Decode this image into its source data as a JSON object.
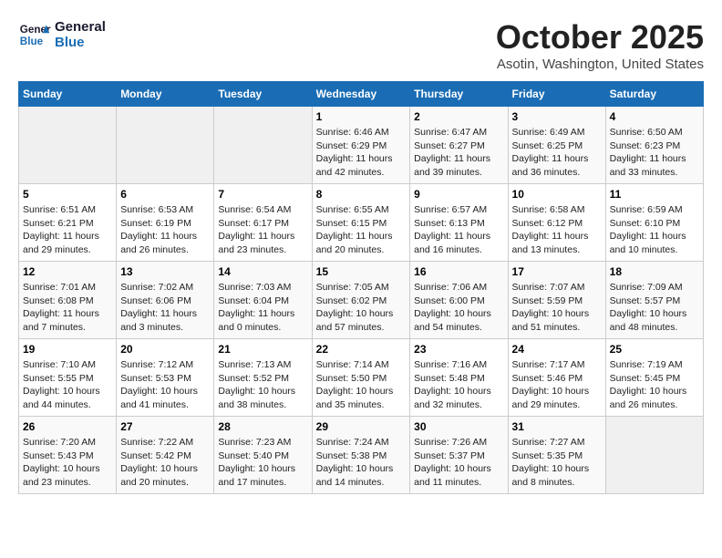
{
  "header": {
    "logo_line1": "General",
    "logo_line2": "Blue",
    "month": "October 2025",
    "location": "Asotin, Washington, United States"
  },
  "days_of_week": [
    "Sunday",
    "Monday",
    "Tuesday",
    "Wednesday",
    "Thursday",
    "Friday",
    "Saturday"
  ],
  "weeks": [
    [
      {
        "day": "",
        "content": ""
      },
      {
        "day": "",
        "content": ""
      },
      {
        "day": "",
        "content": ""
      },
      {
        "day": "1",
        "content": "Sunrise: 6:46 AM\nSunset: 6:29 PM\nDaylight: 11 hours\nand 42 minutes."
      },
      {
        "day": "2",
        "content": "Sunrise: 6:47 AM\nSunset: 6:27 PM\nDaylight: 11 hours\nand 39 minutes."
      },
      {
        "day": "3",
        "content": "Sunrise: 6:49 AM\nSunset: 6:25 PM\nDaylight: 11 hours\nand 36 minutes."
      },
      {
        "day": "4",
        "content": "Sunrise: 6:50 AM\nSunset: 6:23 PM\nDaylight: 11 hours\nand 33 minutes."
      }
    ],
    [
      {
        "day": "5",
        "content": "Sunrise: 6:51 AM\nSunset: 6:21 PM\nDaylight: 11 hours\nand 29 minutes."
      },
      {
        "day": "6",
        "content": "Sunrise: 6:53 AM\nSunset: 6:19 PM\nDaylight: 11 hours\nand 26 minutes."
      },
      {
        "day": "7",
        "content": "Sunrise: 6:54 AM\nSunset: 6:17 PM\nDaylight: 11 hours\nand 23 minutes."
      },
      {
        "day": "8",
        "content": "Sunrise: 6:55 AM\nSunset: 6:15 PM\nDaylight: 11 hours\nand 20 minutes."
      },
      {
        "day": "9",
        "content": "Sunrise: 6:57 AM\nSunset: 6:13 PM\nDaylight: 11 hours\nand 16 minutes."
      },
      {
        "day": "10",
        "content": "Sunrise: 6:58 AM\nSunset: 6:12 PM\nDaylight: 11 hours\nand 13 minutes."
      },
      {
        "day": "11",
        "content": "Sunrise: 6:59 AM\nSunset: 6:10 PM\nDaylight: 11 hours\nand 10 minutes."
      }
    ],
    [
      {
        "day": "12",
        "content": "Sunrise: 7:01 AM\nSunset: 6:08 PM\nDaylight: 11 hours\nand 7 minutes."
      },
      {
        "day": "13",
        "content": "Sunrise: 7:02 AM\nSunset: 6:06 PM\nDaylight: 11 hours\nand 3 minutes."
      },
      {
        "day": "14",
        "content": "Sunrise: 7:03 AM\nSunset: 6:04 PM\nDaylight: 11 hours\nand 0 minutes."
      },
      {
        "day": "15",
        "content": "Sunrise: 7:05 AM\nSunset: 6:02 PM\nDaylight: 10 hours\nand 57 minutes."
      },
      {
        "day": "16",
        "content": "Sunrise: 7:06 AM\nSunset: 6:00 PM\nDaylight: 10 hours\nand 54 minutes."
      },
      {
        "day": "17",
        "content": "Sunrise: 7:07 AM\nSunset: 5:59 PM\nDaylight: 10 hours\nand 51 minutes."
      },
      {
        "day": "18",
        "content": "Sunrise: 7:09 AM\nSunset: 5:57 PM\nDaylight: 10 hours\nand 48 minutes."
      }
    ],
    [
      {
        "day": "19",
        "content": "Sunrise: 7:10 AM\nSunset: 5:55 PM\nDaylight: 10 hours\nand 44 minutes."
      },
      {
        "day": "20",
        "content": "Sunrise: 7:12 AM\nSunset: 5:53 PM\nDaylight: 10 hours\nand 41 minutes."
      },
      {
        "day": "21",
        "content": "Sunrise: 7:13 AM\nSunset: 5:52 PM\nDaylight: 10 hours\nand 38 minutes."
      },
      {
        "day": "22",
        "content": "Sunrise: 7:14 AM\nSunset: 5:50 PM\nDaylight: 10 hours\nand 35 minutes."
      },
      {
        "day": "23",
        "content": "Sunrise: 7:16 AM\nSunset: 5:48 PM\nDaylight: 10 hours\nand 32 minutes."
      },
      {
        "day": "24",
        "content": "Sunrise: 7:17 AM\nSunset: 5:46 PM\nDaylight: 10 hours\nand 29 minutes."
      },
      {
        "day": "25",
        "content": "Sunrise: 7:19 AM\nSunset: 5:45 PM\nDaylight: 10 hours\nand 26 minutes."
      }
    ],
    [
      {
        "day": "26",
        "content": "Sunrise: 7:20 AM\nSunset: 5:43 PM\nDaylight: 10 hours\nand 23 minutes."
      },
      {
        "day": "27",
        "content": "Sunrise: 7:22 AM\nSunset: 5:42 PM\nDaylight: 10 hours\nand 20 minutes."
      },
      {
        "day": "28",
        "content": "Sunrise: 7:23 AM\nSunset: 5:40 PM\nDaylight: 10 hours\nand 17 minutes."
      },
      {
        "day": "29",
        "content": "Sunrise: 7:24 AM\nSunset: 5:38 PM\nDaylight: 10 hours\nand 14 minutes."
      },
      {
        "day": "30",
        "content": "Sunrise: 7:26 AM\nSunset: 5:37 PM\nDaylight: 10 hours\nand 11 minutes."
      },
      {
        "day": "31",
        "content": "Sunrise: 7:27 AM\nSunset: 5:35 PM\nDaylight: 10 hours\nand 8 minutes."
      },
      {
        "day": "",
        "content": ""
      }
    ]
  ]
}
